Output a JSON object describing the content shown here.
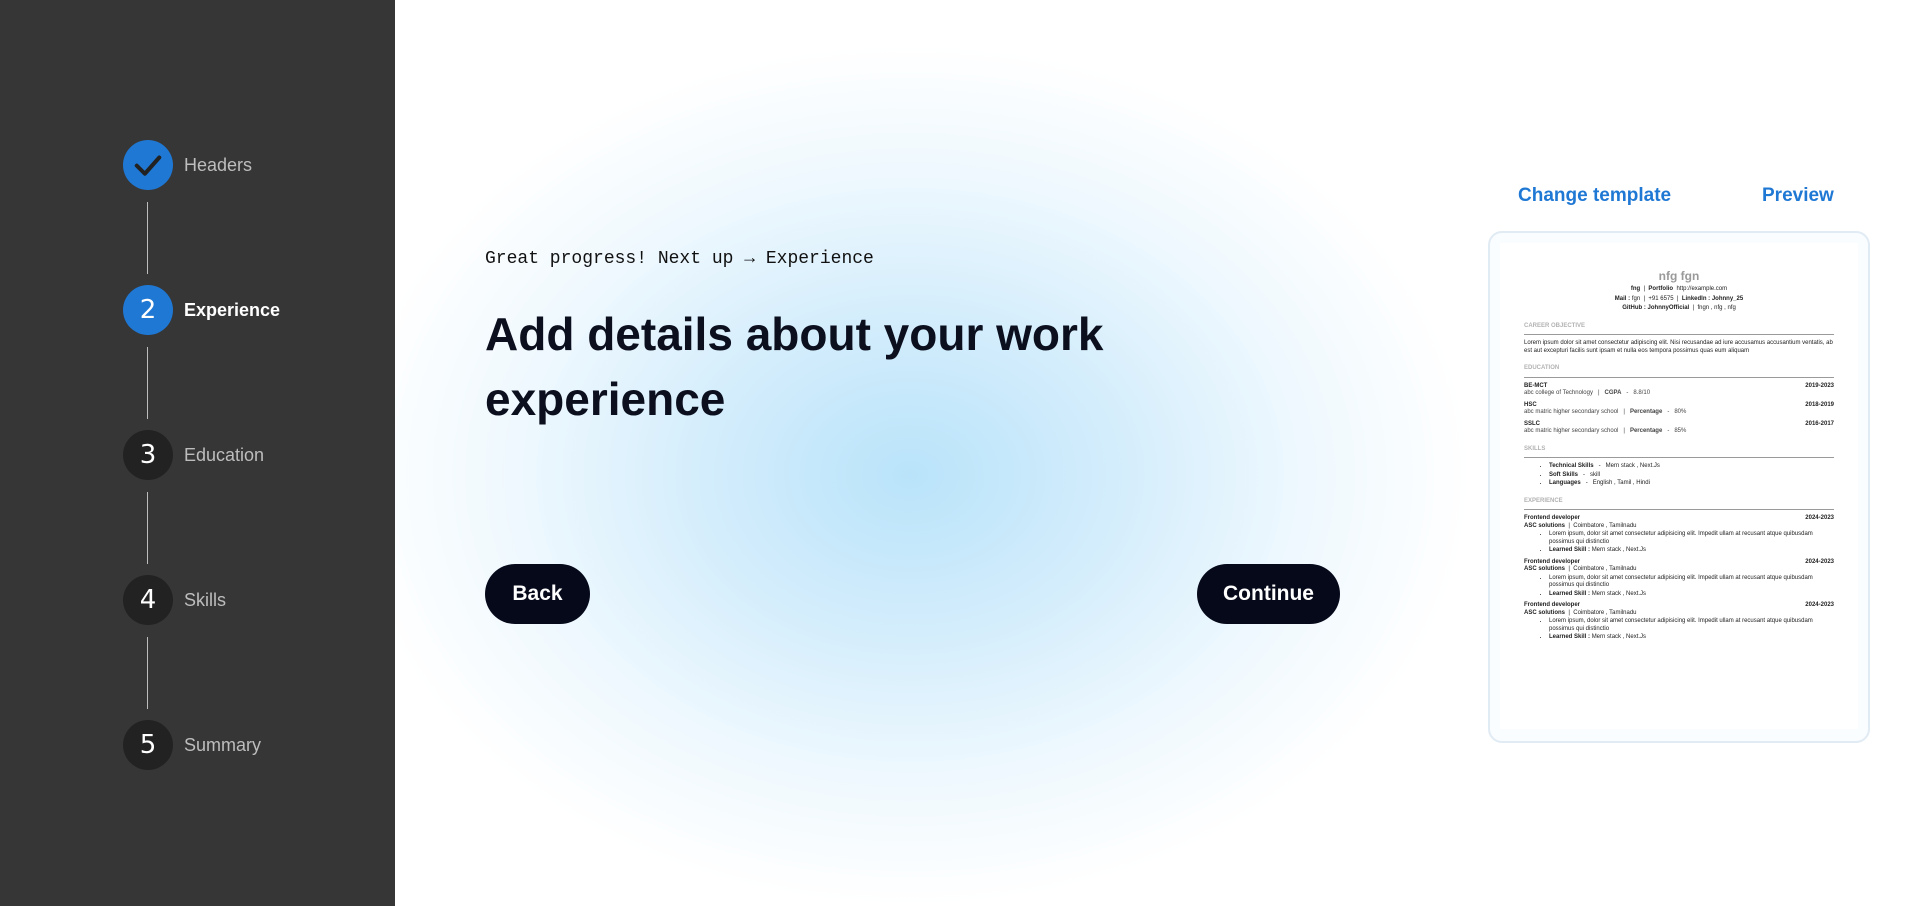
{
  "sidebar": {
    "steps": [
      {
        "number": "",
        "label": "Headers",
        "status": "done",
        "icon": "check-icon"
      },
      {
        "number": "2",
        "label": "Experience",
        "status": "current"
      },
      {
        "number": "3",
        "label": "Education",
        "status": "upcoming"
      },
      {
        "number": "4",
        "label": "Skills",
        "status": "upcoming"
      },
      {
        "number": "5",
        "label": "Summary",
        "status": "upcoming"
      }
    ]
  },
  "main": {
    "kicker": "Great progress! Next up → Experience",
    "headline": "Add details about your work experience",
    "back_label": "Back",
    "continue_label": "Continue"
  },
  "preview": {
    "change_template_label": "Change template",
    "preview_label": "Preview",
    "resume": {
      "name": "nfg fgn",
      "contact1": {
        "a": "fng",
        "portfolio_label": "Portfolio",
        "portfolio": "http://example.com"
      },
      "contact2": {
        "mail_label": "Mail :",
        "mail": "fgn",
        "phone": "+91 6575",
        "linkedin_label": "LinkedIn :",
        "linkedin": "Johnny_25"
      },
      "contact3": {
        "github_label": "GitHub :",
        "github": "JohnnyOfficial",
        "rest": "fngn , nfg , nfg"
      },
      "career_heading": "CAREER OBJECTIVE",
      "career_text": "Lorem ipsum dolor sit amet consectetur adipiscing elit. Nisi recusandae ad iure accusamus accusantium ventatis, ab est aut excepturi facilis sunt ipsam et nulla eos tempora possimus quas eum aliquam",
      "education_heading": "EDUCATION",
      "education": [
        {
          "degree": "BE-MCT",
          "years": "2019-2023",
          "school": "abc college of Technology",
          "metric_label": "CGPA",
          "metric": "8.8/10"
        },
        {
          "degree": "HSC",
          "years": "2018-2019",
          "school": "abc matric higher secondary school",
          "metric_label": "Percentage",
          "metric": "80%"
        },
        {
          "degree": "SSLC",
          "years": "2016-2017",
          "school": "abc matric higher secondary school",
          "metric_label": "Percentage",
          "metric": "85%"
        }
      ],
      "skills_heading": "SKILLS",
      "skills": [
        {
          "label": "Technical Skills",
          "value": "Mern stack ,    Next.Js"
        },
        {
          "label": "Soft Skills",
          "value": "skill"
        },
        {
          "label": "Languages",
          "value": "English ,  Tamil ,  Hindi"
        }
      ],
      "experience_heading": "EXPERIENCE",
      "experience": [
        {
          "role": "Frontend developer",
          "years": "2024-2023",
          "company": "ASC solutions",
          "location": "Coimbatore  ,  Tamilnadu",
          "desc": "Lorem ipsum, dolor sit amet consectetur adipisicing elit. Impedit ullam at recusant atque quibusdam possimus qui distinctio",
          "skills_label": "Learned Skill :",
          "skills": "Mern stack ,   Next.Js"
        },
        {
          "role": "Frontend developer",
          "years": "2024-2023",
          "company": "ASC solutions",
          "location": "Coimbatore  ,  Tamilnadu",
          "desc": "Lorem ipsum, dolor sit amet consectetur adipisicing elit. Impedit ullam at recusant atque quibusdam possimus qui distinctio",
          "skills_label": "Learned Skill :",
          "skills": "Mern stack ,   Next.Js"
        },
        {
          "role": "Frontend developer",
          "years": "2024-2023",
          "company": "ASC solutions",
          "location": "Coimbatore  ,  Tamilnadu",
          "desc": "Lorem ipsum, dolor sit amet consectetur adipisicing elit. Impedit ullam at recusant atque quibusdam possimus qui distinctio",
          "skills_label": "Learned Skill :",
          "skills": "Mern stack ,   Next.Js"
        }
      ]
    }
  },
  "colors": {
    "sidebar_bg": "#363636",
    "accent": "#1f78d4",
    "button_bg": "#05091a"
  }
}
